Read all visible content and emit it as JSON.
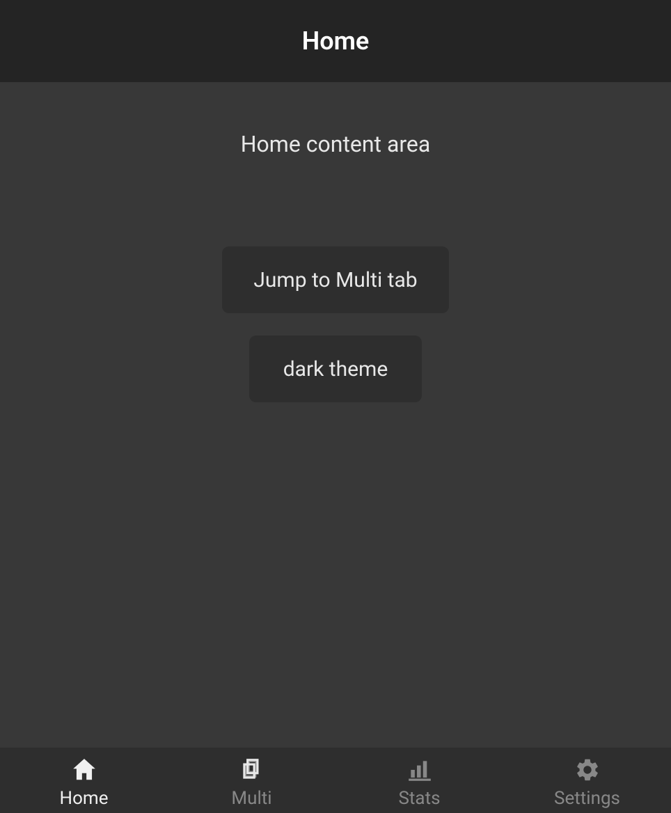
{
  "header": {
    "title": "Home"
  },
  "main": {
    "content_text": "Home content area",
    "buttons": {
      "jump_label": "Jump to Multi tab",
      "theme_label": "dark theme"
    }
  },
  "tabbar": {
    "items": [
      {
        "label": "Home",
        "icon": "home-icon",
        "active": true
      },
      {
        "label": "Multi",
        "icon": "copy-icon",
        "active": false
      },
      {
        "label": "Stats",
        "icon": "stats-icon",
        "active": false
      },
      {
        "label": "Settings",
        "icon": "gear-icon",
        "active": false
      }
    ]
  }
}
